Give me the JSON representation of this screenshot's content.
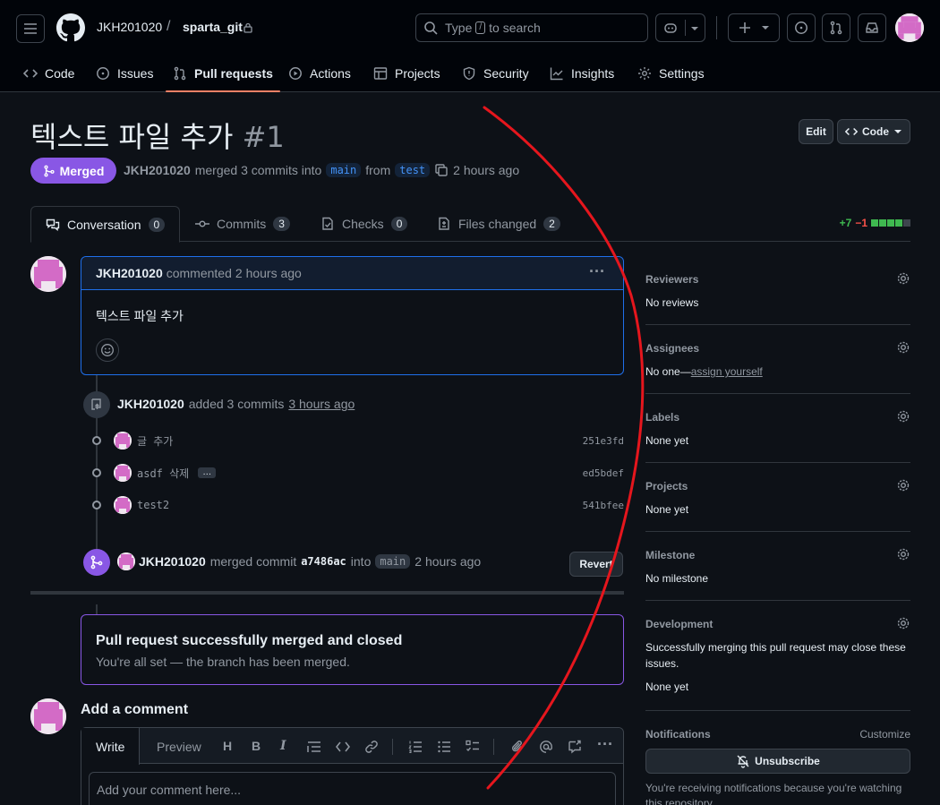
{
  "header": {
    "owner": "JKH201020",
    "separator": "/",
    "repo": "sparta_git",
    "search": {
      "prefix": "Type",
      "key": "/",
      "suffix": "to search"
    }
  },
  "nav": [
    {
      "label": "Code",
      "icon": "code-icon"
    },
    {
      "label": "Issues",
      "icon": "issue-icon"
    },
    {
      "label": "Pull requests",
      "icon": "pull-request-icon",
      "active": true
    },
    {
      "label": "Actions",
      "icon": "play-icon"
    },
    {
      "label": "Projects",
      "icon": "table-icon"
    },
    {
      "label": "Security",
      "icon": "shield-icon"
    },
    {
      "label": "Insights",
      "icon": "graph-icon"
    },
    {
      "label": "Settings",
      "icon": "gear-icon"
    }
  ],
  "pr": {
    "title": "텍스트 파일 추가",
    "number": "#1",
    "edit_label": "Edit",
    "code_label": "Code",
    "state": "Merged",
    "author": "JKH201020",
    "meta_merged": "merged 3 commits into",
    "base": "main",
    "meta_from": "from",
    "head": "test",
    "time": "2 hours ago"
  },
  "tabs": [
    {
      "label": "Conversation",
      "count": "0"
    },
    {
      "label": "Commits",
      "count": "3"
    },
    {
      "label": "Checks",
      "count": "0"
    },
    {
      "label": "Files changed",
      "count": "2"
    }
  ],
  "diffstat": {
    "added": "+7",
    "removed": "−1"
  },
  "comment": {
    "author": "JKH201020",
    "action": "commented",
    "time": "2 hours ago",
    "body": "텍스트 파일 추가",
    "more": "···"
  },
  "commits_event": {
    "author": "JKH201020",
    "action": "added 3 commits",
    "time": "3 hours ago",
    "commits": [
      {
        "message": "글 추가",
        "sha": "251e3fd",
        "more": ""
      },
      {
        "message": "asdf 삭제",
        "sha": "ed5bdef",
        "more": "…"
      },
      {
        "message": "test2",
        "sha": "541bfee",
        "more": ""
      }
    ]
  },
  "merge_event": {
    "author": "JKH201020",
    "action": "merged commit",
    "sha": "a7486ac",
    "into": "into",
    "branch": "main",
    "time": "2 hours ago",
    "revert_label": "Revert"
  },
  "merged_box": {
    "title": "Pull request successfully merged and closed",
    "subtitle": "You're all set — the branch has been merged."
  },
  "add_comment": {
    "title": "Add a comment",
    "write_tab": "Write",
    "preview_tab": "Preview",
    "placeholder": "Add your comment here..."
  },
  "sidebar": {
    "reviewers": {
      "title": "Reviewers",
      "value": "No reviews"
    },
    "assignees": {
      "title": "Assignees",
      "value": "No one—",
      "link": "assign yourself"
    },
    "labels": {
      "title": "Labels",
      "value": "None yet"
    },
    "projects": {
      "title": "Projects",
      "value": "None yet"
    },
    "milestone": {
      "title": "Milestone",
      "value": "No milestone"
    },
    "development": {
      "title": "Development",
      "desc": "Successfully merging this pull request may close these issues.",
      "value": "None yet"
    },
    "notifications": {
      "title": "Notifications",
      "customize": "Customize",
      "unsubscribe": "Unsubscribe",
      "desc": "You're receiving notifications because you're watching this repository."
    }
  },
  "colors": {
    "merged": "#8957e5",
    "accent": "#1f6feb",
    "added": "#3fb950",
    "removed": "#f85149",
    "annotation": "#e5161d"
  }
}
